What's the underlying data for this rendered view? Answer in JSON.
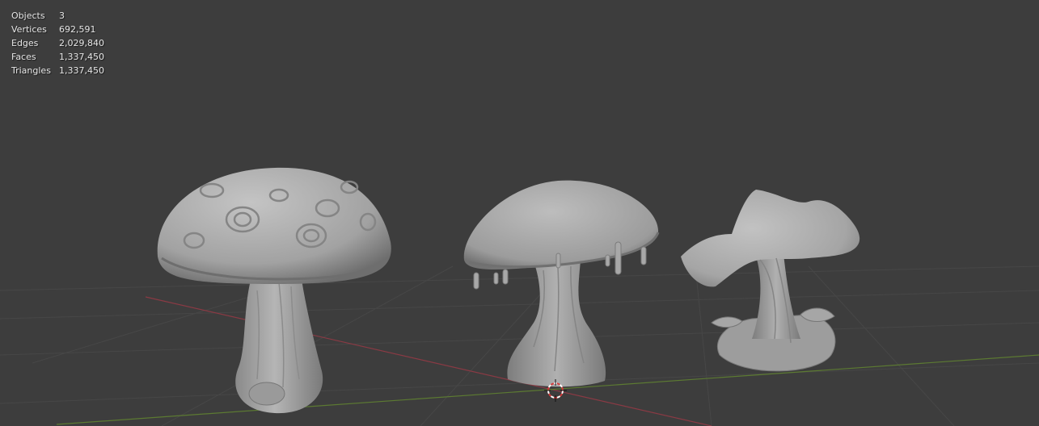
{
  "stats": {
    "rows": [
      {
        "label": "Objects",
        "value": "3"
      },
      {
        "label": "Vertices",
        "value": "692,591"
      },
      {
        "label": "Edges",
        "value": "2,029,840"
      },
      {
        "label": "Faces",
        "value": "1,337,450"
      },
      {
        "label": "Triangles",
        "value": "1,337,450"
      }
    ]
  },
  "colors": {
    "background": "#3d3d3d",
    "grid": "#484848",
    "x_axis": "#8a3a44",
    "y_axis": "#5c7a32",
    "model": "#a9a9a9",
    "cursor_red": "#d23c3c"
  },
  "scene": {
    "objects": [
      "spotted-mushroom",
      "dripping-mushroom",
      "wavy-cap-mushroom"
    ],
    "cursor_icon": "3d-cursor-icon"
  }
}
